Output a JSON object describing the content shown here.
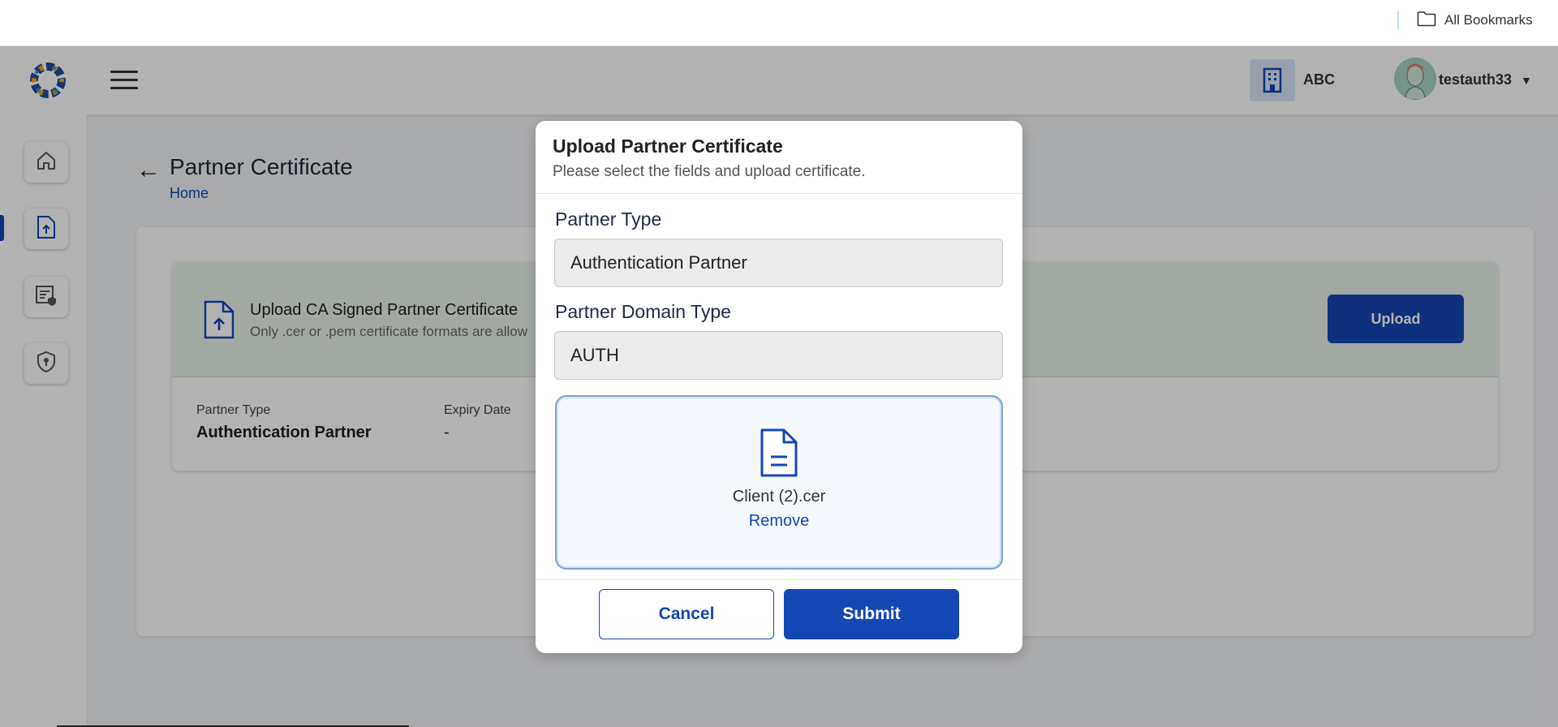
{
  "bookmarks": {
    "label": "All Bookmarks",
    "icon": "folder-icon"
  },
  "header": {
    "org_name": "ABC",
    "user_name": "testauth33",
    "caret": "▼"
  },
  "sidebar": {
    "items": [
      {
        "icon": "home-icon"
      },
      {
        "icon": "upload-certificate-icon",
        "active": true
      },
      {
        "icon": "policy-document-icon"
      },
      {
        "icon": "shield-key-icon"
      }
    ]
  },
  "page": {
    "title": "Partner Certificate",
    "breadcrumb": "Home"
  },
  "certificate_panel": {
    "title": "Upload CA Signed Partner Certificate",
    "subtitle": "Only .cer or .pem certificate formats are allow",
    "upload_label": "Upload",
    "partner_type_label": "Partner Type",
    "partner_type_value": "Authentication Partner",
    "expiry_label": "Expiry Date",
    "expiry_value": "-"
  },
  "modal": {
    "title": "Upload Partner Certificate",
    "subtitle": "Please select the fields and upload certificate.",
    "partner_type_label": "Partner Type",
    "partner_type_value": "Authentication Partner",
    "domain_type_label": "Partner Domain Type",
    "domain_type_value": "AUTH",
    "file_name": "Client (2).cer",
    "remove_label": "Remove",
    "cancel_label": "Cancel",
    "submit_label": "Submit"
  },
  "colors": {
    "primary": "#1447b3",
    "panel_green": "#e8f3ea",
    "overlay": "rgba(0,0,0,0.30)"
  }
}
